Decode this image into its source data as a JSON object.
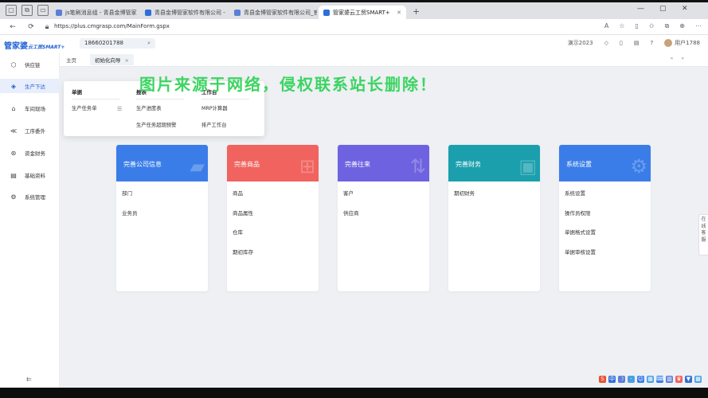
{
  "browser": {
    "tabs": [
      {
        "title": "js笔刷消息组 - 青县金博管家",
        "active": false
      },
      {
        "title": "青县金博管家软件有限公司 - ",
        "active": false
      },
      {
        "title": "青县金博管家软件有限公司_官",
        "active": false
      },
      {
        "title": "管家婆云工贸SMART+",
        "active": true
      }
    ],
    "url": "https://plus.cmgrasp.com/MainForm.gspx"
  },
  "header": {
    "logo_main": "管家婆",
    "logo_sub": "云工贸SMART+",
    "search_value": "18660201788",
    "demo_label": "演示2023",
    "user_label": "用户1788"
  },
  "sidebar": {
    "items": [
      {
        "label": "供应链",
        "icon": "cube-icon"
      },
      {
        "label": "生产下达",
        "icon": "layers-icon",
        "active": true
      },
      {
        "label": "车间现场",
        "icon": "home-icon"
      },
      {
        "label": "工序委外",
        "icon": "share-icon"
      },
      {
        "label": "资金财务",
        "icon": "coin-icon"
      },
      {
        "label": "基础资料",
        "icon": "book-icon"
      },
      {
        "label": "系统管理",
        "icon": "gear-icon"
      }
    ],
    "collapse_glyph": "⇇"
  },
  "page_tabs": {
    "home": "主页",
    "active": "初始化向导",
    "close": "×"
  },
  "watermark": "图片来源于网络，侵权联系站长删除！",
  "dropdown": {
    "columns": [
      {
        "head": "单据",
        "items": [
          "生产任务单"
        ]
      },
      {
        "head": "报表",
        "items": [
          "生产进度表",
          "生产任务超期预警"
        ]
      },
      {
        "head": "工作台",
        "items": [
          "MRP计算器",
          "排产工作台"
        ]
      }
    ]
  },
  "cards": [
    {
      "title": "完善公司信息",
      "color": "#3a7de8",
      "items": [
        "部门",
        "业务员"
      ]
    },
    {
      "title": "完善商品",
      "color": "#f0635e",
      "items": [
        "商品",
        "商品属性",
        "仓库",
        "期初库存"
      ]
    },
    {
      "title": "完善往来",
      "color": "#6f62e0",
      "items": [
        "客户",
        "供应商"
      ]
    },
    {
      "title": "完善财务",
      "color": "#1b9fad",
      "items": [
        "期初财务"
      ]
    },
    {
      "title": "系统设置",
      "color": "#3a7de8",
      "items": [
        "系统设置",
        "操作员权限",
        "单据格式设置",
        "单据审核设置"
      ]
    }
  ],
  "side_float": [
    "在",
    "线",
    "客",
    "服"
  ]
}
